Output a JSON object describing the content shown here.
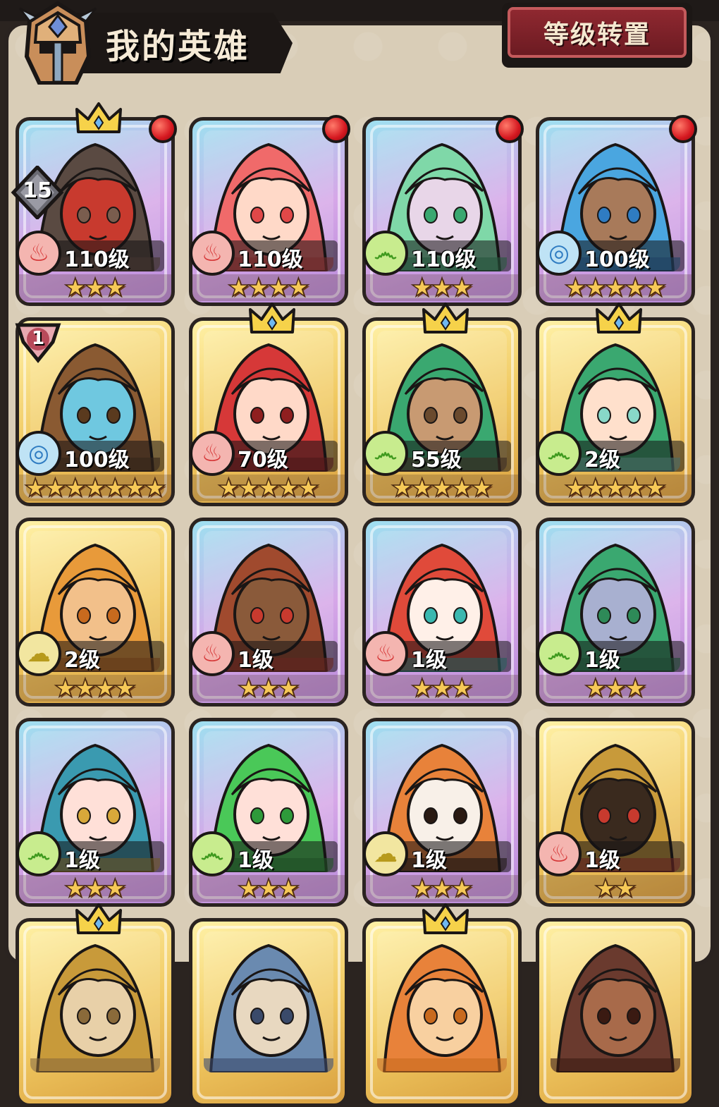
{
  "header": {
    "title": "我的英雄",
    "level_reset_label": "等级转置"
  },
  "colors": {
    "panel_bg": "#d9cdb7",
    "button_red": "#8f2830",
    "star_gold": "#f6c957",
    "fire": "#d63838",
    "wind": "#3f9a1e",
    "water": "#2f7cc2",
    "earth": "#b79a1c"
  },
  "heroes": [
    {
      "level": "110级",
      "stars": 3,
      "element": "fire",
      "frame": "purple",
      "crown": true,
      "red_dot": true,
      "badge": "15",
      "portrait": "minotaur"
    },
    {
      "level": "110级",
      "stars": 4,
      "element": "fire",
      "frame": "purple",
      "crown": false,
      "red_dot": true,
      "badge": "",
      "portrait": "red-hair-girl"
    },
    {
      "level": "110级",
      "stars": 3,
      "element": "wind",
      "frame": "purple",
      "crown": false,
      "red_dot": true,
      "badge": "",
      "portrait": "green-sorceress"
    },
    {
      "level": "100级",
      "stars": 5,
      "element": "water",
      "frame": "purple",
      "crown": false,
      "red_dot": true,
      "badge": "",
      "portrait": "blue-hair-elf"
    },
    {
      "level": "100级",
      "stars": 7,
      "element": "water",
      "frame": "gold",
      "crown": false,
      "red_dot": false,
      "badge": "1",
      "portrait": "wooden-golem"
    },
    {
      "level": "70级",
      "stars": 5,
      "element": "fire",
      "frame": "gold",
      "crown": true,
      "red_dot": false,
      "badge": "",
      "portrait": "monocle-girl"
    },
    {
      "level": "55级",
      "stars": 5,
      "element": "wind",
      "frame": "gold",
      "crown": true,
      "red_dot": false,
      "badge": "",
      "portrait": "tattoo-warrior"
    },
    {
      "level": "2级",
      "stars": 5,
      "element": "wind",
      "frame": "gold",
      "crown": true,
      "red_dot": false,
      "badge": "",
      "portrait": "elf-priestess"
    },
    {
      "level": "2级",
      "stars": 4,
      "element": "earth",
      "frame": "gold",
      "crown": false,
      "red_dot": false,
      "badge": "",
      "portrait": "bearded-dwarf"
    },
    {
      "level": "1级",
      "stars": 3,
      "element": "fire",
      "frame": "purple",
      "crown": false,
      "red_dot": false,
      "badge": "",
      "portrait": "bandana-fighter"
    },
    {
      "level": "1级",
      "stars": 3,
      "element": "fire",
      "frame": "purple",
      "crown": false,
      "red_dot": false,
      "badge": "",
      "portrait": "masked-dragon"
    },
    {
      "level": "1级",
      "stars": 3,
      "element": "wind",
      "frame": "purple",
      "crown": false,
      "red_dot": false,
      "badge": "",
      "portrait": "glasses-elder"
    },
    {
      "level": "1级",
      "stars": 3,
      "element": "wind",
      "frame": "purple",
      "crown": false,
      "red_dot": false,
      "badge": "",
      "portrait": "teal-princess"
    },
    {
      "level": "1级",
      "stars": 3,
      "element": "wind",
      "frame": "purple",
      "crown": false,
      "red_dot": false,
      "badge": "",
      "portrait": "green-hair-girl"
    },
    {
      "level": "1级",
      "stars": 3,
      "element": "earth",
      "frame": "purple",
      "crown": false,
      "red_dot": false,
      "badge": "",
      "portrait": "tiger"
    },
    {
      "level": "1级",
      "stars": 2,
      "element": "fire",
      "frame": "gold",
      "crown": false,
      "red_dot": false,
      "badge": "",
      "portrait": "spartan-helmet"
    },
    {
      "level": "",
      "stars": 0,
      "element": "",
      "frame": "gold",
      "crown": true,
      "red_dot": false,
      "badge": "",
      "portrait": "partial-1"
    },
    {
      "level": "",
      "stars": 0,
      "element": "",
      "frame": "gold",
      "crown": false,
      "red_dot": false,
      "badge": "",
      "portrait": "partial-2"
    },
    {
      "level": "",
      "stars": 0,
      "element": "",
      "frame": "gold",
      "crown": true,
      "red_dot": false,
      "badge": "",
      "portrait": "partial-3"
    },
    {
      "level": "",
      "stars": 0,
      "element": "",
      "frame": "gold",
      "crown": false,
      "red_dot": false,
      "badge": "",
      "portrait": "partial-4"
    }
  ]
}
